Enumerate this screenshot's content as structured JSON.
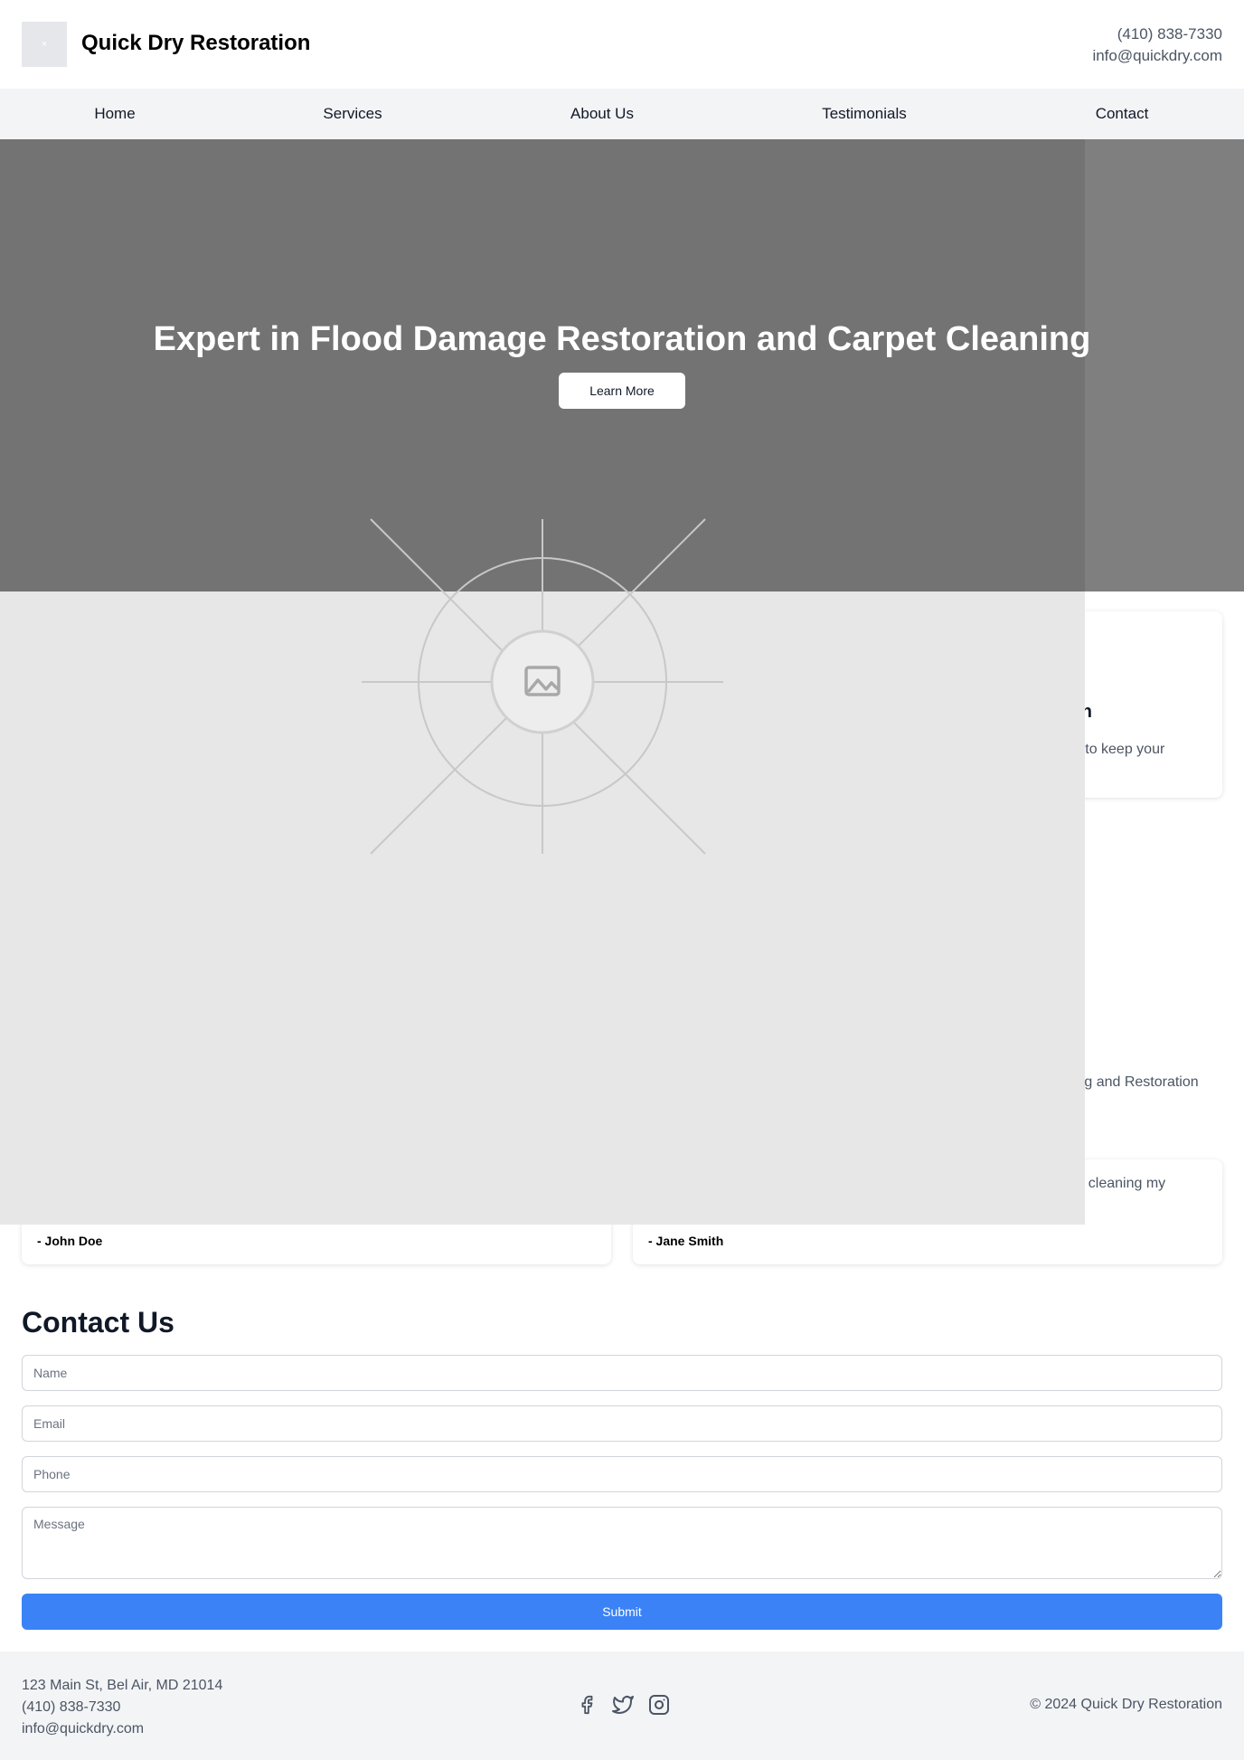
{
  "header": {
    "logo_text": "×",
    "brand": "Quick Dry Restoration",
    "phone": "(410) 838-7330",
    "email": "info@quickdry.com"
  },
  "nav": {
    "items": [
      "Home",
      "Services",
      "About Us",
      "Testimonials",
      "Contact"
    ]
  },
  "hero": {
    "title": "Expert in Flood Damage Restoration and Carpet Cleaning",
    "button": "Learn More"
  },
  "services": {
    "card_title_fragment": "ion",
    "card_desc_fragment": "on to keep your"
  },
  "about": {
    "text_fragment": "ning and Restoration"
  },
  "testimonials": {
    "quote_fragment": "job cleaning my",
    "authors": [
      "- John Doe",
      "- Jane Smith"
    ]
  },
  "contact": {
    "heading": "Contact Us",
    "name_placeholder": "Name",
    "email_placeholder": "Email",
    "phone_placeholder": "Phone",
    "message_placeholder": "Message",
    "submit": "Submit"
  },
  "footer": {
    "address": "123 Main St, Bel Air, MD 21014",
    "phone": "(410) 838-7330",
    "email": "info@quickdry.com",
    "social_icons": [
      "facebook-icon",
      "twitter-icon",
      "instagram-icon"
    ],
    "copyright": "© 2024 Quick Dry Restoration"
  },
  "colors": {
    "accent": "#3b82f6",
    "hero_overlay": "#7f7f7f",
    "nav_bg": "#f3f4f6",
    "placeholder_bg": "#e7e7e7"
  }
}
